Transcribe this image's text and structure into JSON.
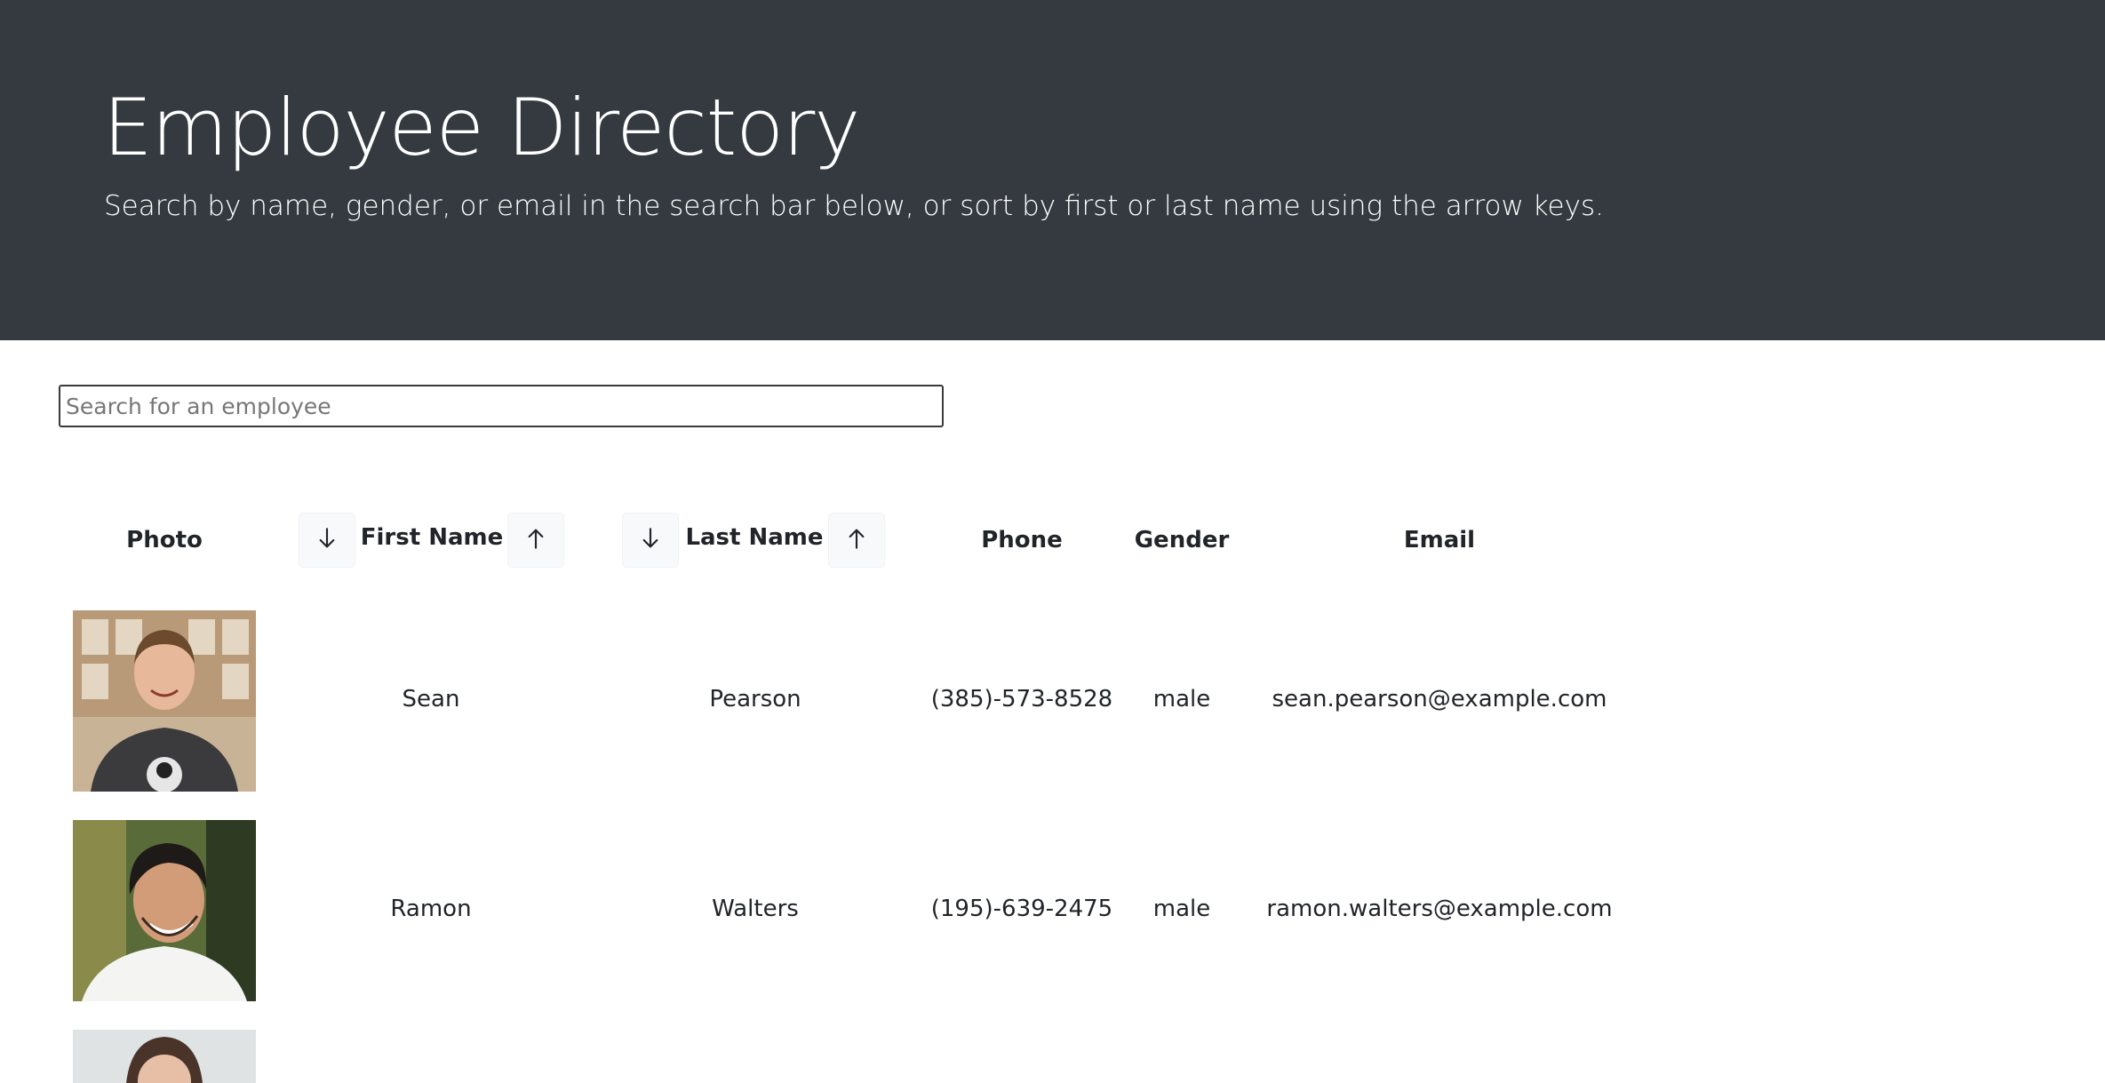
{
  "header": {
    "title": "Employee Directory",
    "subtitle": "Search by name, gender, or email in the search bar below, or sort by first or last name using the arrow keys."
  },
  "search": {
    "placeholder": "Search for an employee",
    "value": ""
  },
  "table": {
    "headers": {
      "photo": "Photo",
      "first_name": "First Name",
      "last_name": "Last Name",
      "phone": "Phone",
      "gender": "Gender",
      "email": "Email"
    },
    "sort_icons": {
      "descending": "arrow-down-icon",
      "ascending": "arrow-up-icon"
    },
    "rows": [
      {
        "photo": "employee-photo",
        "first_name": "Sean",
        "last_name": "Pearson",
        "phone": "(385)-573-8528",
        "gender": "male",
        "email": "sean.pearson@example.com"
      },
      {
        "photo": "employee-photo",
        "first_name": "Ramon",
        "last_name": "Walters",
        "phone": "(195)-639-2475",
        "gender": "male",
        "email": "ramon.walters@example.com"
      },
      {
        "photo": "employee-photo"
      }
    ]
  },
  "colors": {
    "header_bg": "#343a40",
    "header_text": "#ffffff",
    "button_bg": "#f8f9fa",
    "text": "#212529"
  }
}
